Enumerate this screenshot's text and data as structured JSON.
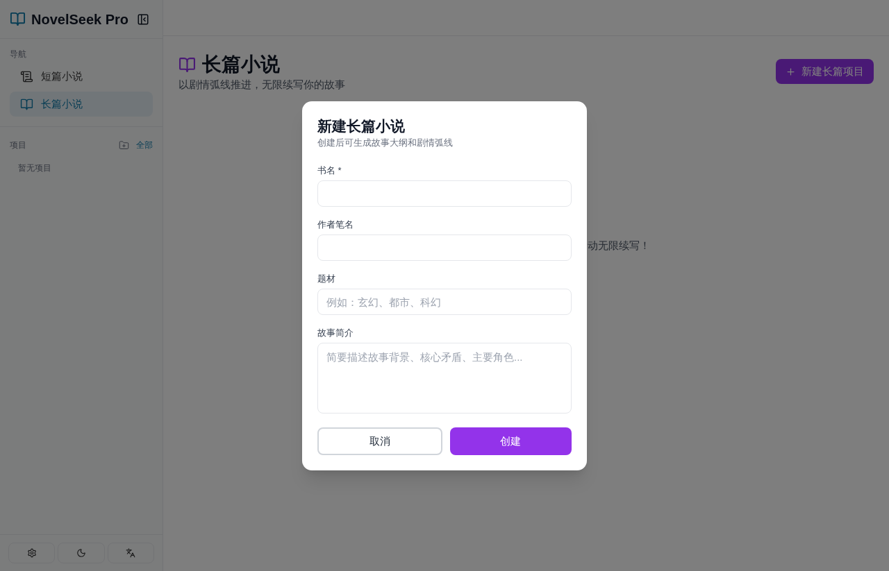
{
  "sidebar": {
    "app_title": "NovelSeek Pro",
    "nav_label": "导航",
    "nav_items": [
      {
        "kind": "scroll",
        "label": "短篇小说",
        "selected": false
      },
      {
        "kind": "book",
        "label": "长篇小说",
        "selected": true
      }
    ],
    "projects_label": "项目",
    "projects_link": "全部",
    "projects_empty": "暂无项目"
  },
  "page": {
    "title": "长篇小说",
    "subtitle": "以剧情弧线推进，无限续写你的故事",
    "new_button": "新建长篇项目",
    "empty_text": "动无限续写！"
  },
  "dialog": {
    "title": "新建长篇小说",
    "subtitle": "创建后可生成故事大纲和剧情弧线",
    "fields": [
      {
        "kind": "input",
        "label": "书名 *"
      },
      {
        "kind": "input",
        "label": "作者笔名"
      },
      {
        "kind": "input",
        "label": "题材",
        "placeholder": "例如：玄幻、都市、科幻"
      },
      {
        "kind": "textarea",
        "label": "故事简介",
        "placeholder": "简要描述故事背景、核心矛盾、主要角色..."
      }
    ],
    "buttons": [
      {
        "kind": "secondary",
        "label": "取消"
      },
      {
        "kind": "primary",
        "label": "创建"
      }
    ]
  }
}
